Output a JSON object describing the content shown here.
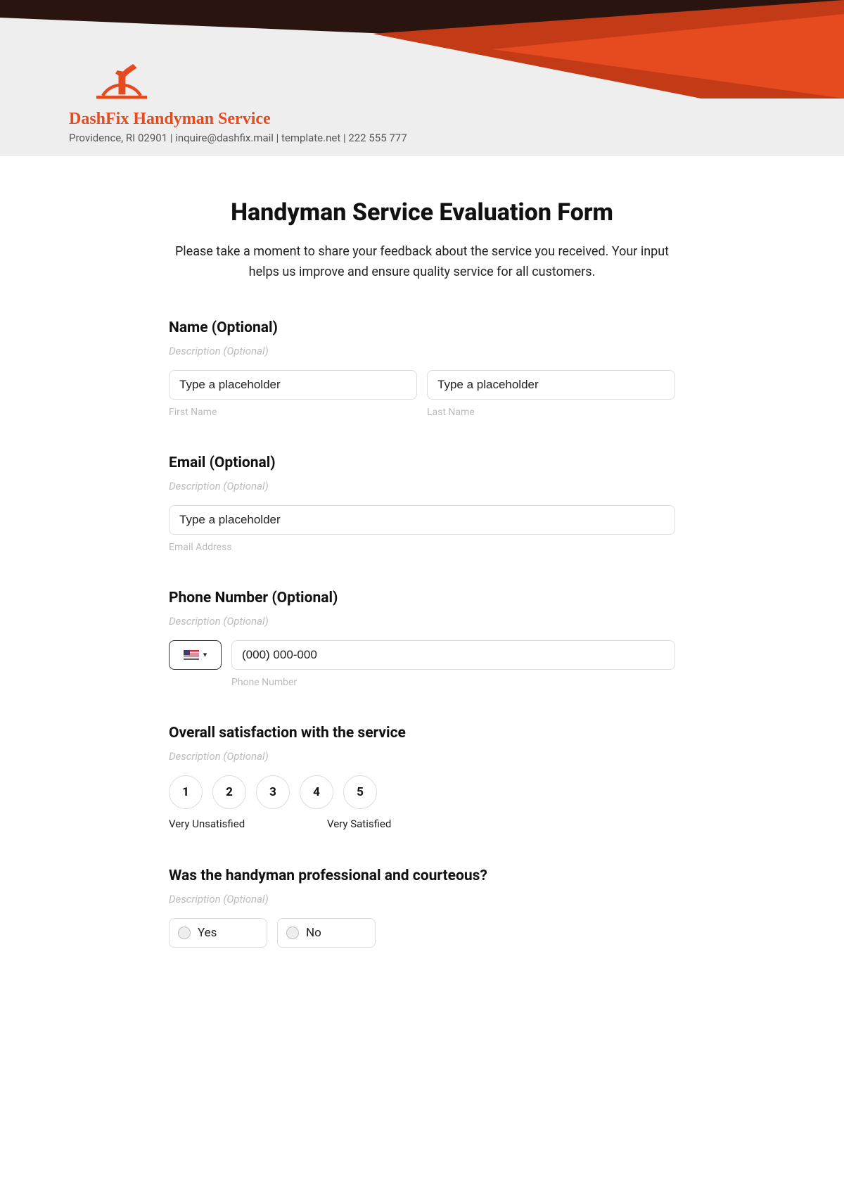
{
  "header": {
    "company_name": "DashFix Handyman Service",
    "company_info": "Providence, RI 02901 | inquire@dashfix.mail | template.net | 222 555 777"
  },
  "form": {
    "title": "Handyman Service Evaluation Form",
    "subtitle": "Please take a moment to share your feedback about the service you received. Your input helps us improve and ensure quality service for all customers.",
    "name": {
      "label": "Name (Optional)",
      "desc": "Description (Optional)",
      "first_placeholder": "Type a placeholder",
      "last_placeholder": "Type a placeholder",
      "first_sub": "First Name",
      "last_sub": "Last Name"
    },
    "email": {
      "label": "Email (Optional)",
      "desc": "Description (Optional)",
      "placeholder": "Type a placeholder",
      "sub": "Email Address"
    },
    "phone": {
      "label": "Phone Number (Optional)",
      "desc": "Description (Optional)",
      "placeholder": "(000) 000-000",
      "sub": "Phone Number"
    },
    "satisfaction": {
      "label": "Overall satisfaction with the service",
      "desc": "Description (Optional)",
      "ratings": [
        "1",
        "2",
        "3",
        "4",
        "5"
      ],
      "low_label": "Very Unsatisfied",
      "high_label": "Very Satisfied"
    },
    "professional": {
      "label": "Was the handyman professional and courteous?",
      "desc": "Description (Optional)",
      "options": [
        "Yes",
        "No"
      ]
    }
  }
}
